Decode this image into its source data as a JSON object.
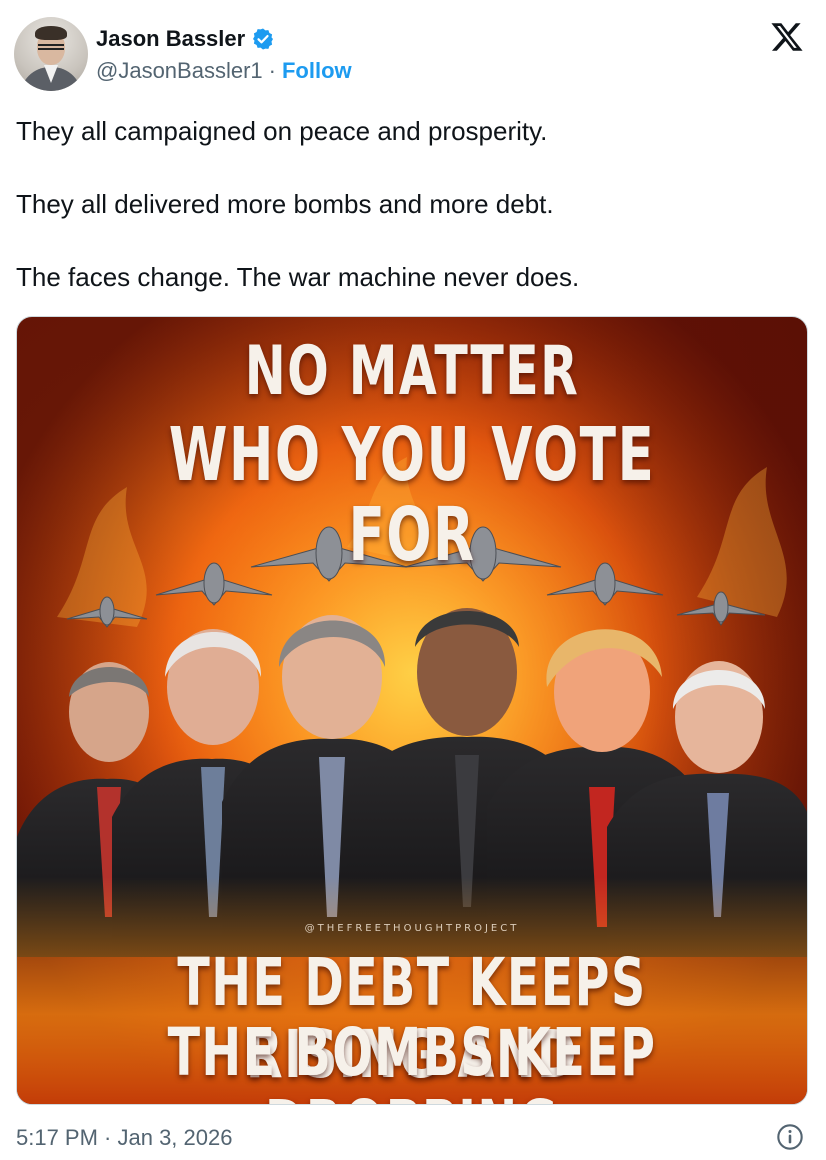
{
  "author": {
    "display_name": "Jason Bassler",
    "handle": "@JasonBassler1",
    "separator": "·",
    "follow_label": "Follow"
  },
  "tweet": {
    "paragraphs": [
      "They all campaigned on peace and prosperity.",
      "They all delivered more bombs and more debt.",
      "The faces change. The war machine never does."
    ],
    "timestamp": "5:17 PM · Jan 3, 2026"
  },
  "media": {
    "headline_line1": "NO MATTER",
    "headline_line2": "WHO YOU VOTE FOR",
    "watermark": "@THEFREETHOUGHTPROJECT",
    "bottom_line1": "THE DEBT KEEPS RISING AND",
    "bottom_line2": "THE BOMBS KEEP DROPPING"
  },
  "icons": {
    "verified": "verified-badge-icon",
    "platform": "x-logo-icon",
    "info": "info-icon"
  },
  "colors": {
    "link": "#1d9bf0",
    "secondary_text": "#536471",
    "primary_text": "#0f1419"
  }
}
